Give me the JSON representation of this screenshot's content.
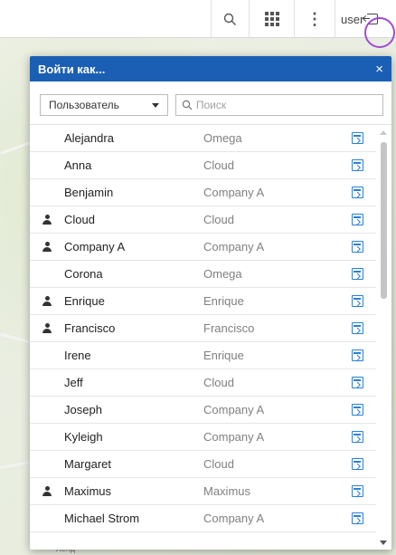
{
  "topbar": {
    "user_label": "user"
  },
  "dialog": {
    "title": "Войти как...",
    "close_label": "×",
    "role_select": "Пользователь",
    "search_placeholder": "Поиск"
  },
  "map": {
    "label": "Ленд"
  },
  "users": [
    {
      "name": "Alejandra",
      "company": "Omega",
      "admin": false
    },
    {
      "name": "Anna",
      "company": "Cloud",
      "admin": false
    },
    {
      "name": "Benjamin",
      "company": "Company A",
      "admin": false
    },
    {
      "name": "Cloud",
      "company": "Cloud",
      "admin": true
    },
    {
      "name": "Company A",
      "company": "Company A",
      "admin": true
    },
    {
      "name": "Corona",
      "company": "Omega",
      "admin": false
    },
    {
      "name": "Enrique",
      "company": "Enrique",
      "admin": true
    },
    {
      "name": "Francisco",
      "company": "Francisco",
      "admin": true
    },
    {
      "name": "Irene",
      "company": "Enrique",
      "admin": false
    },
    {
      "name": "Jeff",
      "company": "Cloud",
      "admin": false
    },
    {
      "name": "Joseph",
      "company": "Company A",
      "admin": false
    },
    {
      "name": "Kyleigh",
      "company": "Company A",
      "admin": false
    },
    {
      "name": "Margaret",
      "company": "Cloud",
      "admin": false
    },
    {
      "name": "Maximus",
      "company": "Maximus",
      "admin": true
    },
    {
      "name": "Michael Strom",
      "company": "Company A",
      "admin": false
    }
  ],
  "colors": {
    "header": "#1b5fb4",
    "accent": "#2b7fd4",
    "highlight": "#a14ad6"
  }
}
